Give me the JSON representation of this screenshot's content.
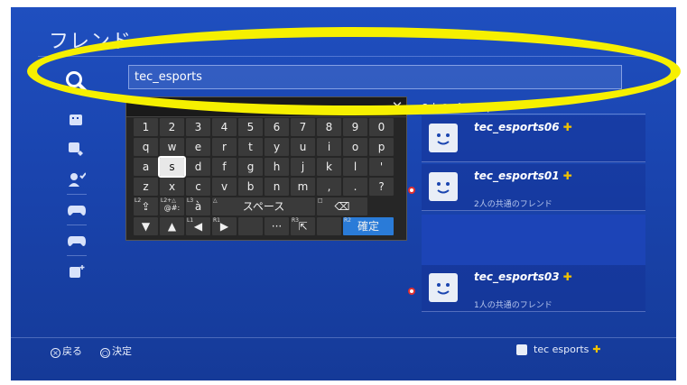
{
  "screen": {
    "title": "フレンド"
  },
  "search": {
    "value": "tec_esports",
    "icon": "search-icon"
  },
  "nav": [
    {
      "icon": "friends-icon"
    },
    {
      "icon": "friend-requests-icon"
    },
    {
      "icon": "add-friend-icon"
    },
    {
      "icon": "gamepad-icon"
    },
    {
      "icon": "gamepad-icon"
    },
    {
      "icon": "profile-plus-icon"
    }
  ],
  "keyboard": {
    "close": "✕",
    "rows": [
      [
        "1",
        "2",
        "3",
        "4",
        "5",
        "6",
        "7",
        "8",
        "9",
        "0"
      ],
      [
        "q",
        "w",
        "e",
        "r",
        "t",
        "y",
        "u",
        "i",
        "o",
        "p"
      ],
      [
        "a",
        "s",
        "d",
        "f",
        "g",
        "h",
        "j",
        "k",
        "l",
        "'"
      ],
      [
        "z",
        "x",
        "c",
        "v",
        "b",
        "n",
        "m",
        ",",
        ".",
        "?"
      ]
    ],
    "l2_sub": "L2",
    "l2_plus_sub": "L2+△",
    "l2_plus_label": "@#:",
    "l3_sub": "L3",
    "accent_label": "à",
    "tri_sub": "△",
    "space_label": "スペース",
    "square_sub": "□",
    "l1_sub": "L1",
    "r1_sub": "R1",
    "r3_sub": "R3",
    "dots_label": "···",
    "r2_sub": "R2",
    "confirm_label": "確定"
  },
  "players": {
    "header": "8人のプレーヤー",
    "items": [
      {
        "name": "tec_esports06",
        "mutual": ""
      },
      {
        "name": "tec_esports01",
        "mutual": "2人の共通のフレンド"
      },
      {
        "name": "tec_esports03",
        "mutual": "1人の共通のフレンド"
      }
    ]
  },
  "footer": {
    "back_glyph": "×",
    "back_label": "戻る",
    "ok_glyph": "○",
    "ok_label": "決定",
    "user_name": "tec esports"
  },
  "colors": {
    "accent_plus": "#f2c200",
    "annotation": "#f6f000",
    "confirm": "#2a7bd8"
  }
}
